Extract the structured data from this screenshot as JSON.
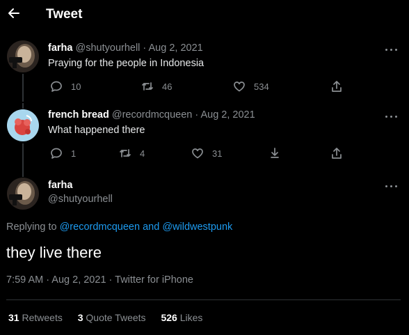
{
  "header": {
    "title": "Tweet"
  },
  "thread": [
    {
      "name": "farha",
      "handle": "@shutyourhell",
      "date": "Aug 2, 2021",
      "text": "Praying for the people in Indonesia",
      "replies": "10",
      "retweets": "46",
      "likes": "534"
    },
    {
      "name": "french bread",
      "handle": "@recordmcqueen",
      "date": "Aug 2, 2021",
      "text": "What happened there",
      "replies": "1",
      "retweets": "4",
      "likes": "31"
    }
  ],
  "main": {
    "name": "farha",
    "handle": "@shutyourhell",
    "replying_prefix": "Replying to",
    "replying_user1": "@recordmcqueen",
    "replying_and": "and",
    "replying_user2": "@wildwestpunk",
    "text": "they live there",
    "time": "7:59 AM",
    "date": "Aug 2, 2021",
    "source": "Twitter for iPhone",
    "retweets_count": "31",
    "retweets_label": "Retweets",
    "quote_count": "3",
    "quote_label": "Quote Tweets",
    "likes_count": "526",
    "likes_label": "Likes"
  },
  "colors": {
    "link": "#1d9bf0",
    "muted": "#8b8f93",
    "background": "#000000"
  },
  "icons": [
    "back-arrow-icon",
    "more-icon",
    "reply-icon",
    "retweet-icon",
    "like-icon",
    "share-icon",
    "bookmark-icon"
  ]
}
